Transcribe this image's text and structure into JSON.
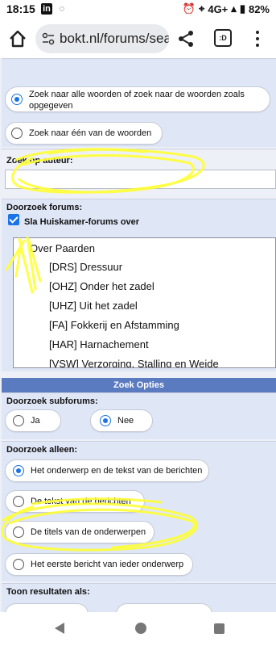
{
  "statusbar": {
    "time": "18:15",
    "linkedin_badge": "in",
    "network": "4G+",
    "battery": "82%"
  },
  "browser": {
    "url": "bokt.nl/forums/sea",
    "tabs_count": ":D"
  },
  "search_mode": {
    "all_words_label": "Zoek naar alle woorden of zoek naar de woorden zoals opgegeven",
    "any_word_label": "Zoek naar één van de woorden",
    "selected": "all_words"
  },
  "author": {
    "label": "Zoek op auteur:",
    "value": ""
  },
  "forums": {
    "label": "Doorzoek forums:",
    "skip_checkbox_label": "Sla Huiskamer-forums over",
    "skip_checked": true,
    "list": [
      "Over Paarden",
      "[DRS] Dressuur",
      "[OHZ] Onder het zadel",
      "[UHZ] Uit het zadel",
      "[FA] Fokkerij en Afstamming",
      "[HAR] Harnachement",
      "[VSW] Verzorging, Stalling en Weide"
    ]
  },
  "options": {
    "header": "Zoek Opties",
    "subforums_label": "Doorzoek subforums:",
    "subforums_yes": "Ja",
    "subforums_no": "Nee",
    "subforums_selected": "no",
    "only_label": "Doorzoek alleen:",
    "only_subject_and_text": "Het onderwerp en de tekst van de berichten",
    "only_text": "De tekst van de berichten",
    "only_titles": "De titels van de onderwerpen",
    "only_first_post": "Het eerste bericht van ieder onderwerp",
    "only_selected": "subject_and_text",
    "show_results_label": "Toon resultaten als:"
  },
  "colors": {
    "accent": "#1a73e8",
    "panel": "#dfe6f6",
    "header": "#5b7bc0",
    "annotation": "#ffff33"
  }
}
